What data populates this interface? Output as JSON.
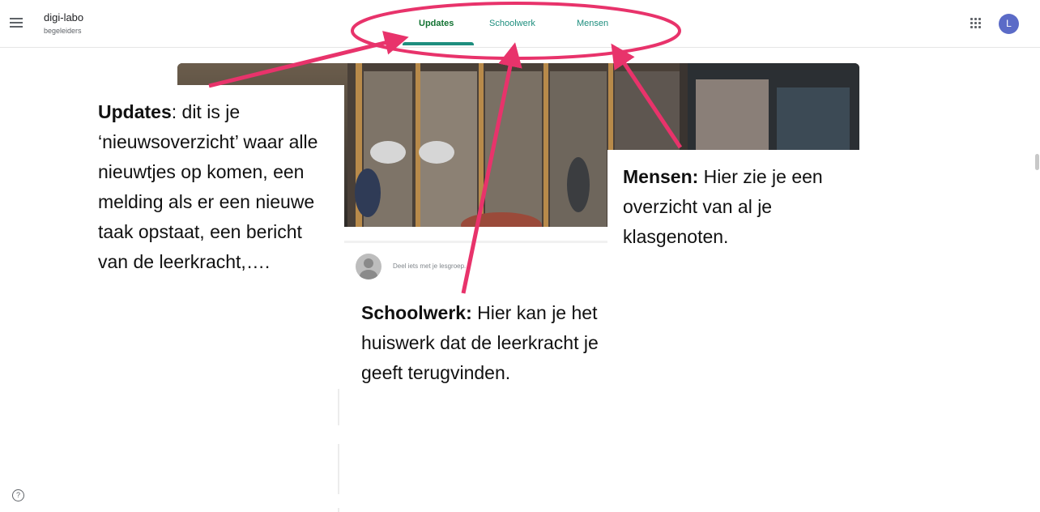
{
  "header": {
    "class_name": "digi-labo",
    "class_section": "begeleiders",
    "tabs": [
      {
        "label": "Updates",
        "active": true
      },
      {
        "label": "Schoolwerk",
        "active": false
      },
      {
        "label": "Mensen",
        "active": false
      }
    ],
    "avatar_initial": "L",
    "icons": [
      "menu-icon",
      "apps-grid-icon",
      "help-icon"
    ]
  },
  "stream": {
    "share_placeholder": "Deel iets met je lesgroep..."
  },
  "annotations": {
    "updates": {
      "title": "Updates",
      "text": ": dit is je ‘nieuwsoverzicht’ waar alle nieuwtjes op komen, een melding als er een nieuwe taak opstaat, een bericht van de leerkracht,…."
    },
    "schoolwerk": {
      "title": "Schoolwerk:",
      "text": " Hier kan je het huiswerk dat de leerkracht je geeft terugvinden."
    },
    "mensen": {
      "title": "Mensen:",
      "text": " Hier zie je een overzicht van al je klasgenoten."
    }
  },
  "colors": {
    "accent_teal": "#1e8e7e",
    "avatar": "#5b6bc7",
    "annotation_pink": "#e8336b"
  }
}
